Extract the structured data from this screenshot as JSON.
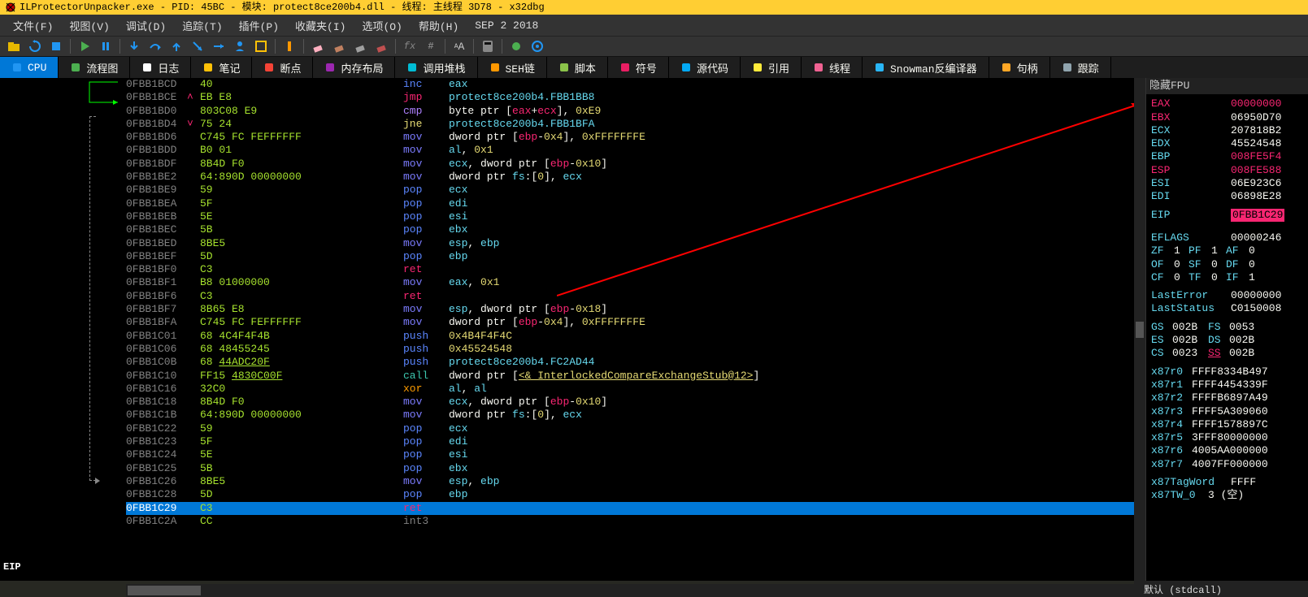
{
  "window_title": "ILProtectorUnpacker.exe - PID: 45BC - 模块: protect8ce200b4.dll - 线程: 主线程 3D78 - x32dbg",
  "menus": [
    "文件(F)",
    "视图(V)",
    "调试(D)",
    "追踪(T)",
    "插件(P)",
    "收藏夹(I)",
    "选项(O)",
    "帮助(H)",
    "SEP 2 2018"
  ],
  "tabs": [
    {
      "label": "CPU",
      "active": true
    },
    {
      "label": "流程图"
    },
    {
      "label": "日志"
    },
    {
      "label": "笔记"
    },
    {
      "label": "断点"
    },
    {
      "label": "内存布局"
    },
    {
      "label": "调用堆栈"
    },
    {
      "label": "SEH链"
    },
    {
      "label": "脚本"
    },
    {
      "label": "符号"
    },
    {
      "label": "源代码"
    },
    {
      "label": "引用"
    },
    {
      "label": "线程"
    },
    {
      "label": "Snowman反编译器"
    },
    {
      "label": "句柄"
    },
    {
      "label": "跟踪"
    }
  ],
  "eip_label": "EIP",
  "rows": [
    {
      "a": "0FBB1BCD",
      "m": "",
      "b": "40",
      "mn": "inc",
      "op": [
        [
          "reg",
          "eax"
        ]
      ]
    },
    {
      "a": "0FBB1BCE",
      "m": "^",
      "b": "EB E8",
      "mn": "jmp",
      "op": [
        [
          "sym",
          "protect8ce200b4.FBB1BB8"
        ]
      ]
    },
    {
      "a": "0FBB1BD0",
      "m": "",
      "b": "803C08 E9",
      "mn": "cmp",
      "op": [
        [
          "w",
          "byte ptr "
        ],
        [
          "w",
          "["
        ],
        [
          "mem",
          "eax"
        ],
        [
          "w",
          "+"
        ],
        [
          "mem",
          "ecx"
        ],
        [
          "w",
          "]"
        ],
        [
          "w",
          ", "
        ],
        [
          "num",
          "0xE9"
        ]
      ]
    },
    {
      "a": "0FBB1BD4",
      "m": "v",
      "b": "75 24",
      "mn": "jne",
      "op": [
        [
          "sym",
          "protect8ce200b4.FBB1BFA"
        ]
      ]
    },
    {
      "a": "0FBB1BD6",
      "m": "",
      "b": "C745 FC FEFFFFFF",
      "mn": "mov",
      "op": [
        [
          "w",
          "dword ptr "
        ],
        [
          "w",
          "["
        ],
        [
          "mem",
          "ebp"
        ],
        [
          "w",
          "-"
        ],
        [
          "num",
          "0x4"
        ],
        [
          "w",
          "]"
        ],
        [
          "w",
          ", "
        ],
        [
          "num",
          "0xFFFFFFFE"
        ]
      ]
    },
    {
      "a": "0FBB1BDD",
      "m": "",
      "b": "B0 01",
      "mn": "mov",
      "op": [
        [
          "reg",
          "al"
        ],
        [
          "w",
          ", "
        ],
        [
          "num",
          "0x1"
        ]
      ]
    },
    {
      "a": "0FBB1BDF",
      "m": "",
      "b": "8B4D F0",
      "mn": "mov",
      "op": [
        [
          "reg",
          "ecx"
        ],
        [
          "w",
          ", "
        ],
        [
          "w",
          "dword ptr "
        ],
        [
          "w",
          "["
        ],
        [
          "mem",
          "ebp"
        ],
        [
          "w",
          "-"
        ],
        [
          "num",
          "0x10"
        ],
        [
          "w",
          "]"
        ]
      ]
    },
    {
      "a": "0FBB1BE2",
      "m": "",
      "b": "64:890D 00000000",
      "mn": "mov",
      "op": [
        [
          "w",
          "dword ptr "
        ],
        [
          "seg",
          "fs"
        ],
        [
          "w",
          ":"
        ],
        [
          "w",
          "["
        ],
        [
          "num",
          "0"
        ],
        [
          "w",
          "]"
        ],
        [
          "w",
          ", "
        ],
        [
          "reg",
          "ecx"
        ]
      ]
    },
    {
      "a": "0FBB1BE9",
      "m": "",
      "b": "59",
      "mn": "pop",
      "op": [
        [
          "reg",
          "ecx"
        ]
      ]
    },
    {
      "a": "0FBB1BEA",
      "m": "",
      "b": "5F",
      "mn": "pop",
      "op": [
        [
          "reg",
          "edi"
        ]
      ]
    },
    {
      "a": "0FBB1BEB",
      "m": "",
      "b": "5E",
      "mn": "pop",
      "op": [
        [
          "reg",
          "esi"
        ]
      ]
    },
    {
      "a": "0FBB1BEC",
      "m": "",
      "b": "5B",
      "mn": "pop",
      "op": [
        [
          "reg",
          "ebx"
        ]
      ]
    },
    {
      "a": "0FBB1BED",
      "m": "",
      "b": "8BE5",
      "mn": "mov",
      "op": [
        [
          "reg",
          "esp"
        ],
        [
          "w",
          ", "
        ],
        [
          "reg",
          "ebp"
        ]
      ]
    },
    {
      "a": "0FBB1BEF",
      "m": "",
      "b": "5D",
      "mn": "pop",
      "op": [
        [
          "reg",
          "ebp"
        ]
      ]
    },
    {
      "a": "0FBB1BF0",
      "m": "",
      "b": "C3",
      "mn": "ret",
      "op": []
    },
    {
      "a": "0FBB1BF1",
      "m": "",
      "b": "B8 01000000",
      "mn": "mov",
      "op": [
        [
          "reg",
          "eax"
        ],
        [
          "w",
          ", "
        ],
        [
          "num",
          "0x1"
        ]
      ]
    },
    {
      "a": "0FBB1BF6",
      "m": "",
      "b": "C3",
      "mn": "ret",
      "op": []
    },
    {
      "a": "0FBB1BF7",
      "m": "",
      "b": "8B65 E8",
      "mn": "mov",
      "op": [
        [
          "reg",
          "esp"
        ],
        [
          "w",
          ", "
        ],
        [
          "w",
          "dword ptr "
        ],
        [
          "w",
          "["
        ],
        [
          "mem",
          "ebp"
        ],
        [
          "w",
          "-"
        ],
        [
          "num",
          "0x18"
        ],
        [
          "w",
          "]"
        ]
      ]
    },
    {
      "a": "0FBB1BFA",
      "m": "",
      "b": "C745 FC FEFFFFFF",
      "mn": "mov",
      "op": [
        [
          "w",
          "dword ptr "
        ],
        [
          "w",
          "["
        ],
        [
          "mem",
          "ebp"
        ],
        [
          "w",
          "-"
        ],
        [
          "num",
          "0x4"
        ],
        [
          "w",
          "]"
        ],
        [
          "w",
          ", "
        ],
        [
          "num",
          "0xFFFFFFFE"
        ]
      ]
    },
    {
      "a": "0FBB1C01",
      "m": "",
      "b": "68 4C4F4F4B",
      "mn": "push",
      "op": [
        [
          "num",
          "0x4B4F4F4C"
        ]
      ]
    },
    {
      "a": "0FBB1C06",
      "m": "",
      "b": "68 48455245",
      "mn": "push",
      "op": [
        [
          "num",
          "0x45524548"
        ]
      ]
    },
    {
      "a": "0FBB1C0B",
      "m": "",
      "b": "68 ",
      "bu": "44ADC20F",
      "mn": "push",
      "op": [
        [
          "sym",
          "protect8ce200b4.FC2AD44"
        ]
      ]
    },
    {
      "a": "0FBB1C10",
      "m": "",
      "b": "FF15 ",
      "bu": "4830C00F",
      "mn": "call",
      "op": [
        [
          "w",
          "dword ptr "
        ],
        [
          "w",
          "["
        ],
        [
          "call",
          "<&_InterlockedCompareExchangeStub@12>"
        ],
        [
          "w",
          "]"
        ]
      ]
    },
    {
      "a": "0FBB1C16",
      "m": "",
      "b": "32C0",
      "mn": "xor",
      "op": [
        [
          "reg",
          "al"
        ],
        [
          "w",
          ", "
        ],
        [
          "reg",
          "al"
        ]
      ]
    },
    {
      "a": "0FBB1C18",
      "m": "",
      "b": "8B4D F0",
      "mn": "mov",
      "op": [
        [
          "reg",
          "ecx"
        ],
        [
          "w",
          ", "
        ],
        [
          "w",
          "dword ptr "
        ],
        [
          "w",
          "["
        ],
        [
          "mem",
          "ebp"
        ],
        [
          "w",
          "-"
        ],
        [
          "num",
          "0x10"
        ],
        [
          "w",
          "]"
        ]
      ]
    },
    {
      "a": "0FBB1C1B",
      "m": "",
      "b": "64:890D 00000000",
      "mn": "mov",
      "op": [
        [
          "w",
          "dword ptr "
        ],
        [
          "seg",
          "fs"
        ],
        [
          "w",
          ":"
        ],
        [
          "w",
          "["
        ],
        [
          "num",
          "0"
        ],
        [
          "w",
          "]"
        ],
        [
          "w",
          ", "
        ],
        [
          "reg",
          "ecx"
        ]
      ]
    },
    {
      "a": "0FBB1C22",
      "m": "",
      "b": "59",
      "mn": "pop",
      "op": [
        [
          "reg",
          "ecx"
        ]
      ]
    },
    {
      "a": "0FBB1C23",
      "m": "",
      "b": "5F",
      "mn": "pop",
      "op": [
        [
          "reg",
          "edi"
        ]
      ]
    },
    {
      "a": "0FBB1C24",
      "m": "",
      "b": "5E",
      "mn": "pop",
      "op": [
        [
          "reg",
          "esi"
        ]
      ]
    },
    {
      "a": "0FBB1C25",
      "m": "",
      "b": "5B",
      "mn": "pop",
      "op": [
        [
          "reg",
          "ebx"
        ]
      ]
    },
    {
      "a": "0FBB1C26",
      "m": "",
      "b": "8BE5",
      "mn": "mov",
      "op": [
        [
          "reg",
          "esp"
        ],
        [
          "w",
          ", "
        ],
        [
          "reg",
          "ebp"
        ]
      ]
    },
    {
      "a": "0FBB1C28",
      "m": "",
      "b": "5D",
      "mn": "pop",
      "op": [
        [
          "reg",
          "ebp"
        ]
      ]
    },
    {
      "a": "0FBB1C29",
      "m": "",
      "b": "C3",
      "mn": "ret",
      "op": [],
      "sel": true
    },
    {
      "a": "0FBB1C2A",
      "m": "",
      "b": "CC",
      "mn": "int3",
      "op": []
    }
  ],
  "reg_header": "隐藏FPU",
  "regs": [
    {
      "n": "EAX",
      "v": "00000000",
      "hot": true
    },
    {
      "n": "EBX",
      "v": "06950D70",
      "hotn": true
    },
    {
      "n": "ECX",
      "v": "207818B2"
    },
    {
      "n": "EDX",
      "v": "45524548"
    },
    {
      "n": "EBP",
      "v": "008FE5F4",
      "hotv": true
    },
    {
      "n": "ESP",
      "v": "008FE588",
      "hotn": true,
      "hotv": true
    },
    {
      "n": "ESI",
      "v": "06E923C6"
    },
    {
      "n": "EDI",
      "v": "06898E28"
    }
  ],
  "eip": {
    "n": "EIP",
    "v": "0FBB1C29"
  },
  "eflags": {
    "label": "EFLAGS",
    "value": "00000246"
  },
  "flags": [
    [
      "ZF",
      "1"
    ],
    [
      "PF",
      "1"
    ],
    [
      "AF",
      "0"
    ],
    [
      "OF",
      "0"
    ],
    [
      "SF",
      "0"
    ],
    [
      "DF",
      "0"
    ],
    [
      "CF",
      "0"
    ],
    [
      "TF",
      "0"
    ],
    [
      "IF",
      "1"
    ]
  ],
  "lasterror": {
    "label": "LastError",
    "value": "00000000"
  },
  "laststatus": {
    "label": "LastStatus",
    "value": "C0150008"
  },
  "segs": [
    [
      "GS",
      "002B"
    ],
    [
      "FS",
      "0053"
    ],
    [
      "ES",
      "002B"
    ],
    [
      "DS",
      "002B"
    ],
    [
      "CS",
      "0023"
    ],
    [
      "SS",
      "002B"
    ]
  ],
  "x87": [
    [
      "x87r0",
      "FFFF8334B497"
    ],
    [
      "x87r1",
      "FFFF4454339F"
    ],
    [
      "x87r2",
      "FFFFB6897A49"
    ],
    [
      "x87r3",
      "FFFF5A309060"
    ],
    [
      "x87r4",
      "FFFF1578897C"
    ],
    [
      "x87r5",
      "3FFF80000000"
    ],
    [
      "x87r6",
      "4005AA000000"
    ],
    [
      "x87r7",
      "4007FF000000"
    ]
  ],
  "x87tag": {
    "label": "x87TagWord",
    "value": "FFFF"
  },
  "x87tw": {
    "label": "x87TW_0",
    "value": "3 (空)"
  },
  "footer": "默认 (stdcall)"
}
